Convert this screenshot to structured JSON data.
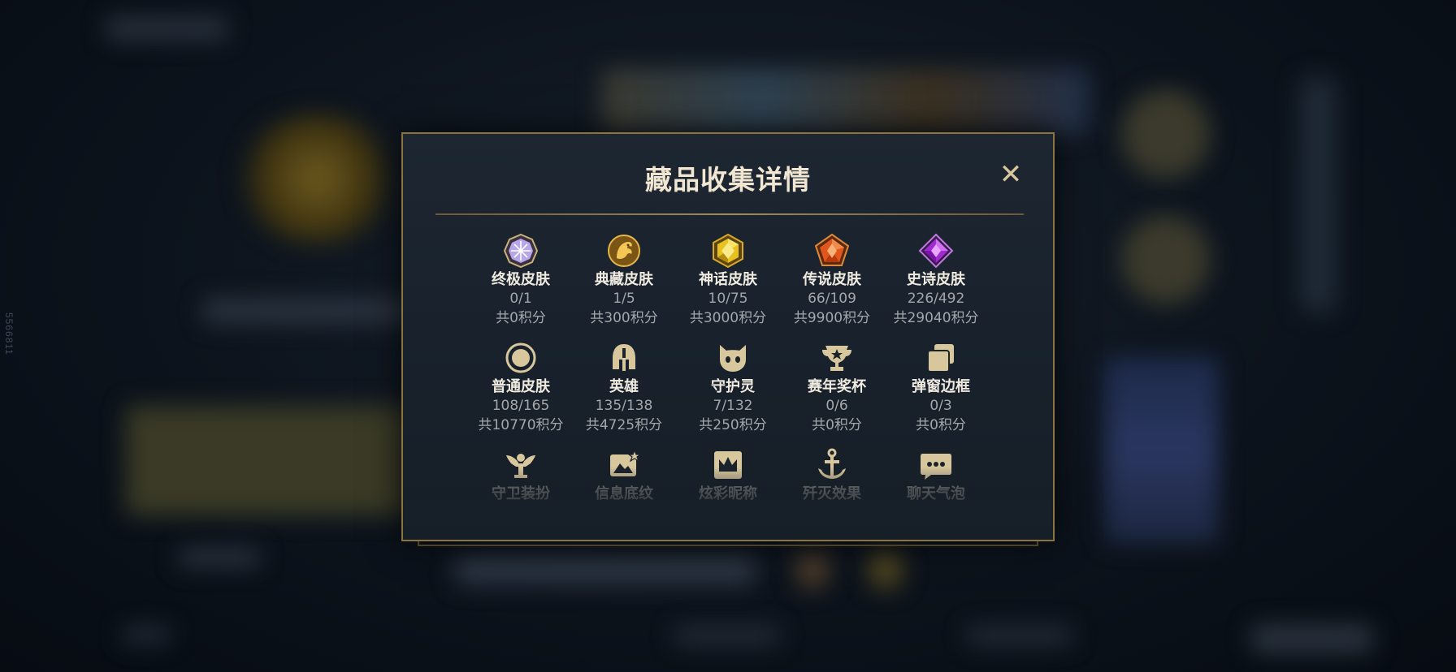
{
  "background": {
    "side_id": "5566811"
  },
  "modal": {
    "title": "藏品收集详情",
    "close_label": "✕",
    "items": [
      {
        "label": "终极皮肤",
        "count": "0/1",
        "points": "共0积分",
        "icon": "ultimate-skin-icon"
      },
      {
        "label": "典藏皮肤",
        "count": "1/5",
        "points": "共300积分",
        "icon": "prestige-skin-icon"
      },
      {
        "label": "神话皮肤",
        "count": "10/75",
        "points": "共3000积分",
        "icon": "mythic-skin-icon"
      },
      {
        "label": "传说皮肤",
        "count": "66/109",
        "points": "共9900积分",
        "icon": "legendary-skin-icon"
      },
      {
        "label": "史诗皮肤",
        "count": "226/492",
        "points": "共29040积分",
        "icon": "epic-skin-icon"
      },
      {
        "label": "普通皮肤",
        "count": "108/165",
        "points": "共10770积分",
        "icon": "standard-skin-icon"
      },
      {
        "label": "英雄",
        "count": "135/138",
        "points": "共4725积分",
        "icon": "champion-helmet-icon"
      },
      {
        "label": "守护灵",
        "count": "7/132",
        "points": "共250积分",
        "icon": "little-legend-icon"
      },
      {
        "label": "赛年奖杯",
        "count": "0/6",
        "points": "共0积分",
        "icon": "trophy-icon"
      },
      {
        "label": "弹窗边框",
        "count": "0/3",
        "points": "共0积分",
        "icon": "popup-frame-icon"
      },
      {
        "label": "守卫装扮",
        "icon": "ward-skin-icon"
      },
      {
        "label": "信息底纹",
        "icon": "banner-icon"
      },
      {
        "label": "炫彩昵称",
        "icon": "crown-nickname-icon"
      },
      {
        "label": "歼灭效果",
        "icon": "anchor-icon"
      },
      {
        "label": "聊天气泡",
        "icon": "chat-bubble-icon"
      }
    ]
  },
  "colors": {
    "gold_border": "#8a7442",
    "title_text": "#f0e6d2",
    "icon_gold": "#d8c79d"
  }
}
